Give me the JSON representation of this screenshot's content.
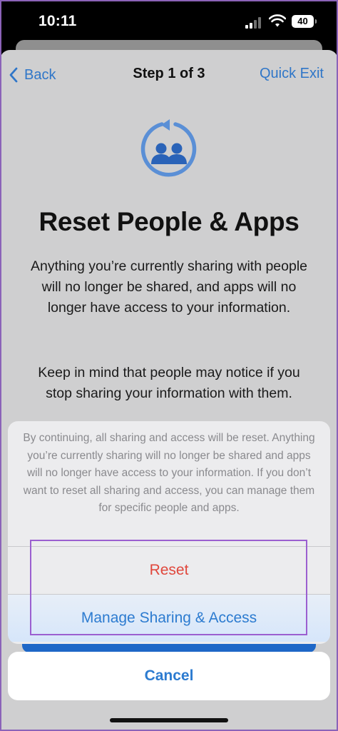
{
  "status_bar": {
    "time": "10:11",
    "battery": "40"
  },
  "nav": {
    "back_label": "Back",
    "title": "Step 1 of 3",
    "quick_exit_label": "Quick Exit"
  },
  "hero": {
    "icon": "people-reset-icon"
  },
  "content": {
    "title": "Reset People & Apps",
    "paragraph1": "Anything you’re currently sharing with people will no longer be shared, and apps will no longer have access to your information.",
    "paragraph2": "Keep in mind that people may notice if you stop sharing your information with them."
  },
  "action_sheet": {
    "message": "By continuing, all sharing and access will be reset. Anything you’re currently sharing will no longer be shared and apps will no longer have access to your information. If you don’t want to reset all sharing and access, you can manage them for specific people and apps.",
    "reset_label": "Reset",
    "manage_label": "Manage Sharing & Access",
    "cancel_label": "Cancel"
  },
  "colors": {
    "accent": "#2c7bd0",
    "destructive": "#e0473c",
    "highlight": "#9b5fd0"
  }
}
